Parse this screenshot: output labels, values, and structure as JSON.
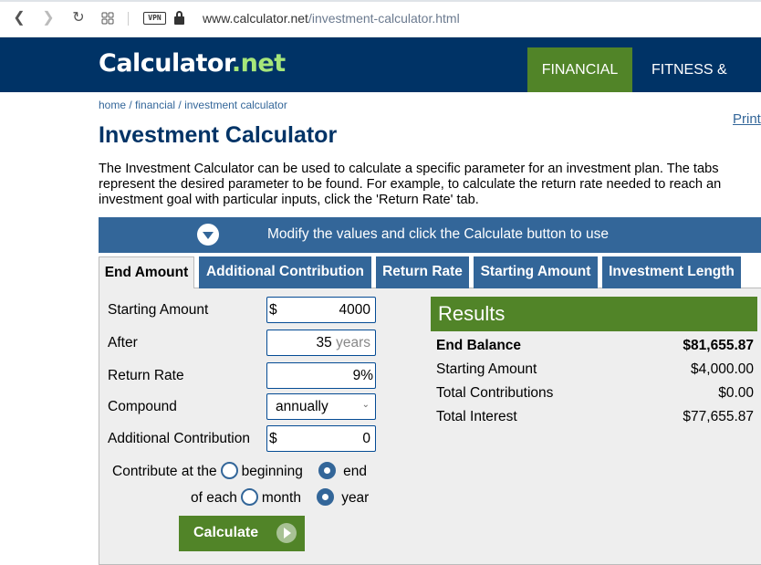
{
  "browser": {
    "url_host": "www.calculator.net",
    "url_path": "/investment-calculator.html",
    "vpn_label": "VPN",
    "icons": [
      "back-icon",
      "forward-icon",
      "reload-icon",
      "tabs-grid-icon",
      "vpn-icon",
      "lock-icon"
    ]
  },
  "header": {
    "logo_main": "Calculator",
    "logo_dot_net": ".net",
    "nav": [
      {
        "label": "FINANCIAL",
        "active": true
      },
      {
        "label": "FITNESS & HEA"
      }
    ],
    "colors": {
      "navy": "#003366",
      "green": "#518428",
      "logo_accent": "#a6e67a"
    }
  },
  "breadcrumb": {
    "items": [
      "home",
      "financial",
      "investment calculator"
    ],
    "separator": " / "
  },
  "print_label": "Print",
  "page_title": "Investment Calculator",
  "intro": "The Investment Calculator can be used to calculate a specific parameter for an investment plan. The tabs represent the desired parameter to be found. For example, to calculate the return rate needed to reach an investment goal with particular inputs, click the 'Return Rate' tab.",
  "modify_bar": {
    "text": "Modify the values and click the Calculate button to use"
  },
  "tabs": [
    {
      "label": "End Amount",
      "active": true
    },
    {
      "label": "Additional Contribution"
    },
    {
      "label": "Return Rate"
    },
    {
      "label": "Starting Amount"
    },
    {
      "label": "Investment Length"
    }
  ],
  "form": {
    "starting_amount": {
      "label": "Starting Amount",
      "prefix": "$",
      "value": "4000"
    },
    "after": {
      "label": "After",
      "value": "35",
      "unit": "years"
    },
    "return_rate": {
      "label": "Return Rate",
      "value": "9",
      "unit": "%"
    },
    "compound": {
      "label": "Compound",
      "value": "annually"
    },
    "additional_contribution": {
      "label": "Additional Contribution",
      "prefix": "$",
      "value": "0"
    },
    "contribute_at": {
      "label": "Contribute at the",
      "options": [
        "beginning",
        "end"
      ],
      "selected": "end"
    },
    "of_each": {
      "label": "of each",
      "options": [
        "month",
        "year"
      ],
      "selected": "year"
    },
    "calculate_label": "Calculate"
  },
  "results": {
    "title": "Results",
    "rows": [
      {
        "label": "End Balance",
        "value": "$81,655.87",
        "bold": true
      },
      {
        "label": "Starting Amount",
        "value": "$4,000.00"
      },
      {
        "label": "Total Contributions",
        "value": "$0.00"
      },
      {
        "label": "Total Interest",
        "value": "$77,655.87"
      }
    ]
  }
}
